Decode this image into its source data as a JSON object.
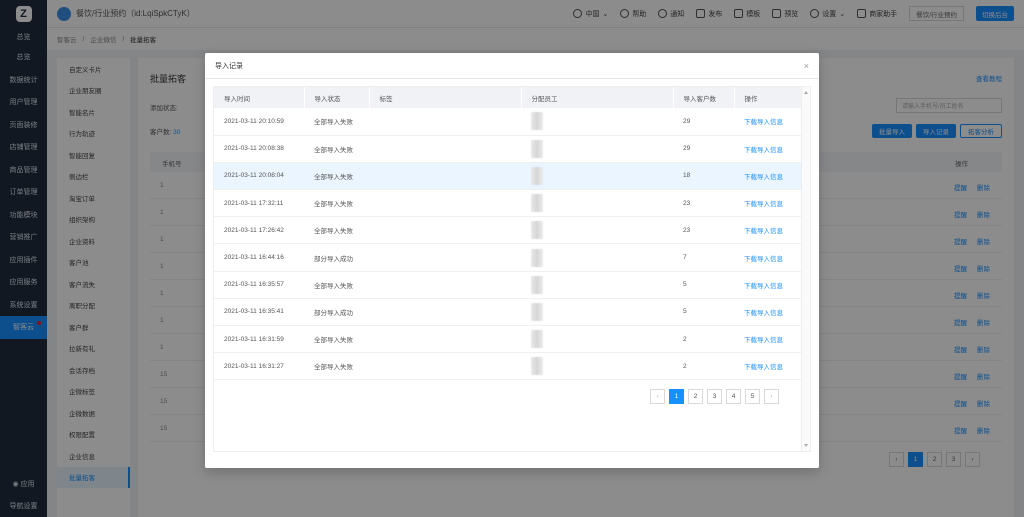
{
  "sidebar": {
    "logo": "Z",
    "top_label": "总览",
    "items": [
      {
        "label": "总览",
        "active": false
      },
      {
        "label": "数据统计",
        "active": false
      },
      {
        "label": "用户管理",
        "active": false
      },
      {
        "label": "页面装修",
        "active": false
      },
      {
        "label": "店铺管理",
        "active": false
      },
      {
        "label": "商品管理",
        "active": false
      },
      {
        "label": "订单管理",
        "active": false
      },
      {
        "label": "功能模块",
        "active": false
      },
      {
        "label": "营销推广",
        "active": false
      },
      {
        "label": "应用插件",
        "active": false
      },
      {
        "label": "应用服务",
        "active": false
      },
      {
        "label": "系统设置",
        "active": false
      },
      {
        "label": "智客云",
        "active": true
      }
    ],
    "bottom": [
      {
        "label": "应用"
      },
      {
        "label": "导航设置"
      }
    ]
  },
  "topbar": {
    "brand": "餐饮/行业预约（id:LqiSpkCTyK）",
    "region": "中国",
    "help": "帮助",
    "notify": "通知",
    "publish": "发布",
    "template": "模板",
    "preview": "预览",
    "settings": "设置",
    "assistant": "商家助手",
    "store_select": "餐饮/行业预约",
    "switch": "切换后台"
  },
  "breadcrumb": [
    "智客云",
    "企业微信",
    "批量拓客"
  ],
  "submenu": [
    {
      "label": "自定义卡片",
      "active": false
    },
    {
      "label": "企业朋友圈",
      "active": false
    },
    {
      "label": "智能名片",
      "active": false
    },
    {
      "label": "行为轨迹",
      "active": false
    },
    {
      "label": "智能回复",
      "active": false
    },
    {
      "label": "侧边栏",
      "active": false
    },
    {
      "label": "淘宝订单",
      "active": false
    },
    {
      "label": "组织架构",
      "active": false
    },
    {
      "label": "企业资料",
      "active": false
    },
    {
      "label": "客户池",
      "active": false
    },
    {
      "label": "客户流失",
      "active": false
    },
    {
      "label": "离职分配",
      "active": false
    },
    {
      "label": "客户群",
      "active": false
    },
    {
      "label": "拉新有礼",
      "active": false
    },
    {
      "label": "会话存档",
      "active": false
    },
    {
      "label": "企微标签",
      "active": false
    },
    {
      "label": "企微数据",
      "active": false
    },
    {
      "label": "权限配置",
      "active": false
    },
    {
      "label": "企业信息",
      "active": false
    },
    {
      "label": "批量拓客",
      "active": true
    }
  ],
  "main": {
    "title": "批量拓客",
    "view_records": "查看教程",
    "filter_label": "添加状态:",
    "count_label": "客户数:",
    "count_value": "30",
    "search_placeholder": "请输入手机号/员工姓名",
    "btn_import": "批量导入",
    "btn_record": "导入记录",
    "btn_analysis": "拓客分析",
    "col_phone": "手机号",
    "col_ops": "操作",
    "op_remind": "提醒",
    "op_delete": "删除",
    "rows": [
      "1",
      "1",
      "1",
      "1",
      "1",
      "1",
      "1",
      "15",
      "15",
      "15"
    ],
    "pages": [
      "1",
      "2",
      "3"
    ]
  },
  "modal": {
    "title": "导入记录",
    "close": "×",
    "columns": [
      "导入时间",
      "导入状态",
      "标签",
      "分配员工",
      "导入客户数",
      "操作"
    ],
    "rows": [
      {
        "time": "2021-03-11 20:10:59",
        "status": "全部导入失败",
        "tag": "",
        "count": "29",
        "action": "下载导入信息",
        "hl": false
      },
      {
        "time": "2021-03-11 20:08:38",
        "status": "全部导入失败",
        "tag": "",
        "count": "29",
        "action": "下载导入信息",
        "hl": false
      },
      {
        "time": "2021-03-11 20:08:04",
        "status": "全部导入失败",
        "tag": "",
        "count": "18",
        "action": "下载导入信息",
        "hl": true
      },
      {
        "time": "2021-03-11 17:32:11",
        "status": "全部导入失败",
        "tag": "",
        "count": "23",
        "action": "下载导入信息",
        "hl": false
      },
      {
        "time": "2021-03-11 17:26:42",
        "status": "全部导入失败",
        "tag": "",
        "count": "23",
        "action": "下载导入信息",
        "hl": false
      },
      {
        "time": "2021-03-11 16:44:16",
        "status": "部分导入成功",
        "tag": "",
        "count": "7",
        "action": "下载导入信息",
        "hl": false
      },
      {
        "time": "2021-03-11 16:35:57",
        "status": "全部导入失败",
        "tag": "",
        "count": "5",
        "action": "下载导入信息",
        "hl": false
      },
      {
        "time": "2021-03-11 16:35:41",
        "status": "部分导入成功",
        "tag": "",
        "count": "5",
        "action": "下载导入信息",
        "hl": false
      },
      {
        "time": "2021-03-11 16:31:59",
        "status": "全部导入失败",
        "tag": "",
        "count": "2",
        "action": "下载导入信息",
        "hl": false
      },
      {
        "time": "2021-03-11 16:31:27",
        "status": "全部导入失败",
        "tag": "",
        "count": "2",
        "action": "下载导入信息",
        "hl": false
      }
    ],
    "pager": {
      "prev": "‹",
      "next": "›",
      "pages": [
        "1",
        "2",
        "3",
        "4",
        "5"
      ],
      "current": "1"
    }
  }
}
